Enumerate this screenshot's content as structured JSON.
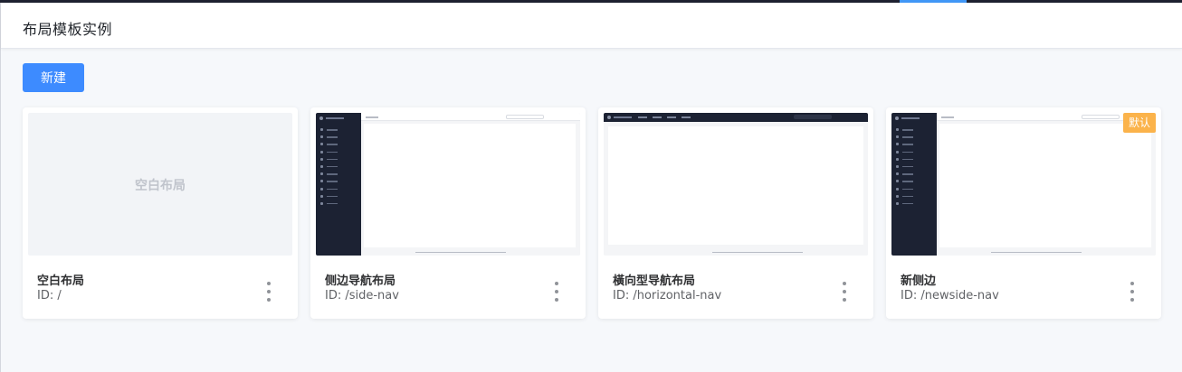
{
  "header": {
    "title": "布局模板实例"
  },
  "toolbar": {
    "new_label": "新建"
  },
  "colors": {
    "primary": "#3d8bff",
    "badge": "#fbb34b",
    "sidebar": "#1c2233"
  },
  "cards": [
    {
      "name": "空白布局",
      "id": "ID: /",
      "preview_type": "blank",
      "preview_label": "空白布局"
    },
    {
      "name": "侧边导航布局",
      "id": "ID: /side-nav",
      "preview_type": "side-nav"
    },
    {
      "name": "橫向型导航布局",
      "id": "ID: /horizontal-nav",
      "preview_type": "horizontal-nav"
    },
    {
      "name": "新侧边",
      "id": "ID: /newside-nav",
      "preview_type": "side-nav",
      "badge": "默认"
    }
  ],
  "icons": {
    "more": "more-vertical-icon"
  }
}
